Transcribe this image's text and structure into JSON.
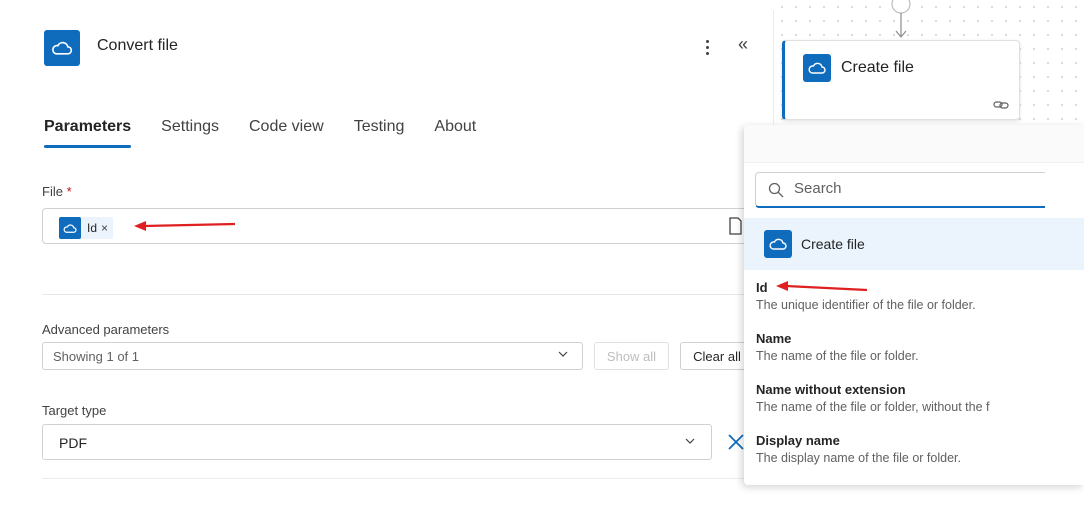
{
  "action_panel": {
    "title": "Convert file",
    "tabs": [
      {
        "label": "Parameters",
        "active": true
      },
      {
        "label": "Settings",
        "active": false
      },
      {
        "label": "Code view",
        "active": false
      },
      {
        "label": "Testing",
        "active": false
      },
      {
        "label": "About",
        "active": false
      }
    ],
    "file_field": {
      "label": "File",
      "required_marker": "*",
      "token_label": "Id",
      "token_remove": "×"
    },
    "advanced_parameters": {
      "label": "Advanced parameters",
      "selected": "Showing 1 of 1",
      "show_all_label": "Show all",
      "clear_all_label": "Clear all"
    },
    "target_type": {
      "label": "Target type",
      "value": "PDF"
    }
  },
  "canvas": {
    "card_title": "Create file"
  },
  "dynamic_content": {
    "search_placeholder": "Search",
    "group_title": "Create file",
    "items": [
      {
        "name": "Id",
        "description": "The unique identifier of the file or folder."
      },
      {
        "name": "Name",
        "description": "The name of the file or folder."
      },
      {
        "name": "Name without extension",
        "description": "The name of the file or folder, without the f"
      },
      {
        "name": "Display name",
        "description": "The display name of the file or folder."
      }
    ]
  },
  "colors": {
    "accent": "#0f6cbd",
    "annotation_arrow": "#e02020",
    "required": "#c50f1f"
  },
  "icons": {
    "connector": "onedrive-cloud-icon",
    "more": "more-vertical-icon",
    "collapse": "double-chevron-left-icon",
    "search": "search-icon"
  }
}
